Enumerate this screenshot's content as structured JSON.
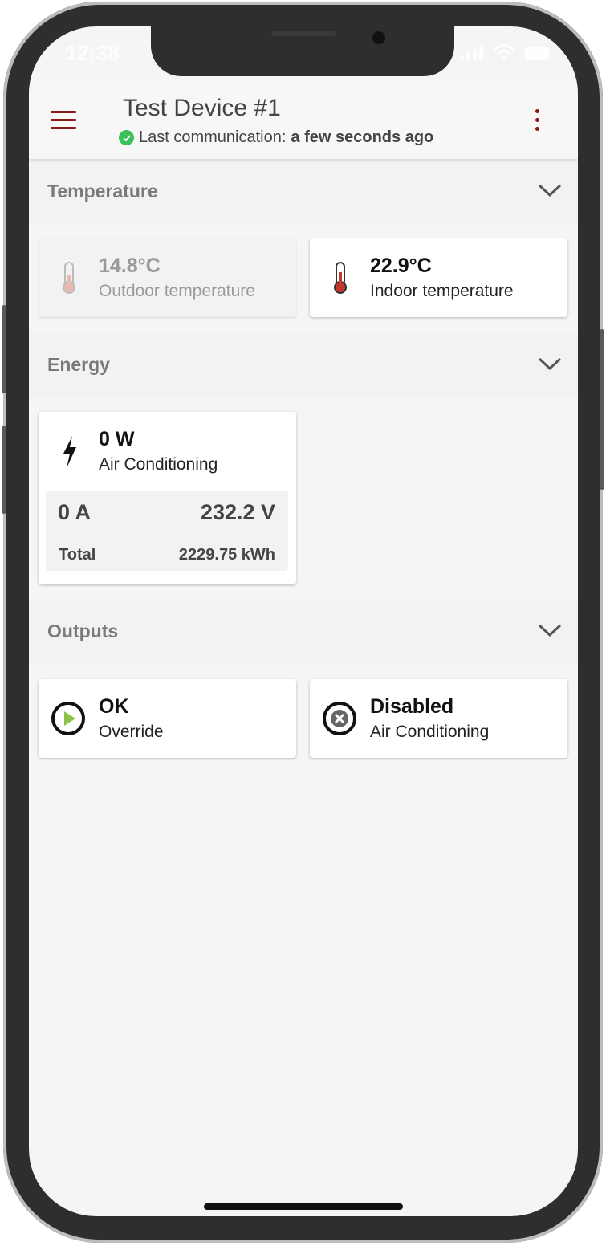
{
  "status_bar": {
    "time": "12:38"
  },
  "header": {
    "title": "Test Device #1",
    "communication_label": "Last communication:",
    "communication_value": "a few seconds ago"
  },
  "sections": {
    "temperature": {
      "title": "Temperature",
      "cards": [
        {
          "value": "14.8°C",
          "label": "Outdoor temperature"
        },
        {
          "value": "22.9°C",
          "label": "Indoor temperature"
        }
      ]
    },
    "energy": {
      "title": "Energy",
      "card": {
        "value": "0 W",
        "label": "Air Conditioning",
        "amps": "0 A",
        "volts": "232.2 V",
        "total_label": "Total",
        "total_value": "2229.75 kWh"
      }
    },
    "outputs": {
      "title": "Outputs",
      "cards": [
        {
          "value": "OK",
          "label": "Override"
        },
        {
          "value": "Disabled",
          "label": "Air Conditioning"
        }
      ]
    }
  },
  "colors": {
    "accent": "#8b1a1a",
    "status_ok": "#3cc15a",
    "play_green": "#8bc34a"
  },
  "icons": {
    "menu": "menu-icon",
    "more": "kebab-icon",
    "thermometer": "thermometer-icon",
    "energy": "lightning-icon",
    "output_ok": "play-circle-icon",
    "output_disabled": "cancel-circle-icon"
  }
}
